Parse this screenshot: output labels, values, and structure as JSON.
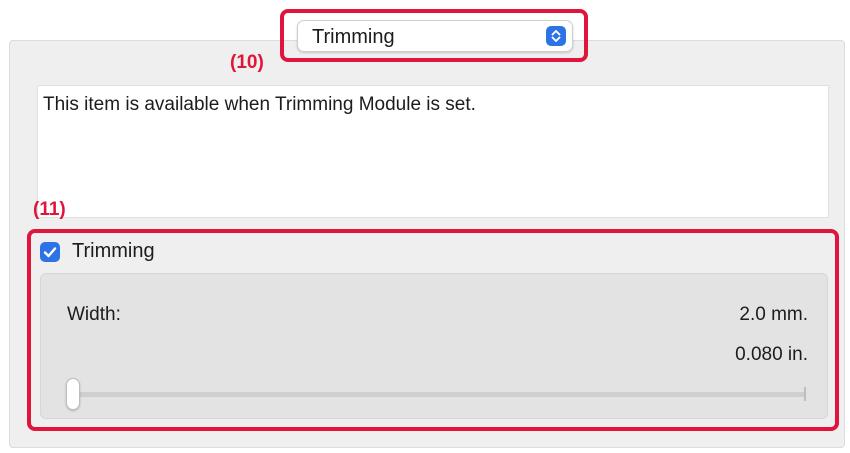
{
  "popup": {
    "selected": "Trimming",
    "icon": "updown-arrows-icon"
  },
  "callouts": {
    "popup": "(10)",
    "trimming": "(11)"
  },
  "description": {
    "text": "This item is available when Trimming Module is set."
  },
  "trimming": {
    "checkbox_label": "Trimming",
    "checked": true,
    "width_label": "Width:",
    "value_mm": "2.0 mm.",
    "value_in": "0.080 in.",
    "slider_level": 0.0
  },
  "colors": {
    "accent": "#2e73e6",
    "highlight": "#e0153c"
  }
}
